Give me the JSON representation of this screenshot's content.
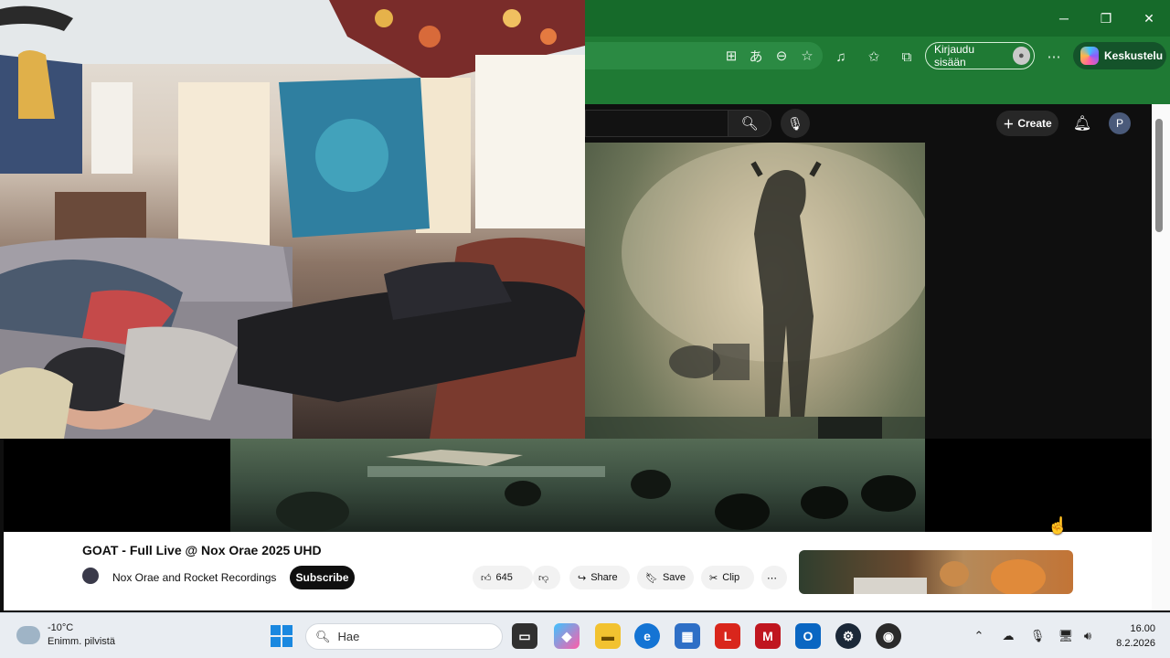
{
  "browser": {
    "window_controls": {
      "minimize": "─",
      "restore": "❐",
      "close": "✕"
    },
    "signin_label": "Kirjaudu sisään",
    "copilot_label": "Keskustelu",
    "more_icon": "⋯"
  },
  "youtube": {
    "create_label": "Create",
    "avatar_letter": "P",
    "video": {
      "title": "GOAT - Full Live @ Nox Orae 2025 UHD",
      "channel": "Nox Orae and Rocket Recordings",
      "subscribe_label": "Subscribe",
      "likes": "645",
      "share_label": "Share",
      "save_label": "Save",
      "clip_label": "Clip"
    }
  },
  "taskbar": {
    "weather": {
      "temp": "-10°C",
      "condition": "Enimm. pilvistä"
    },
    "search_placeholder": "Hae",
    "apps": [
      "file-explorer",
      "copilot",
      "folders",
      "edge",
      "microsoft-store",
      "lastpass",
      "mcafee",
      "outlook-new",
      "steam",
      "obs"
    ],
    "clock": {
      "time": "16.00",
      "date": "8.2.2026"
    }
  },
  "colors": {
    "browser_green": "#1f7a34",
    "youtube_dark": "#0f0f0f",
    "subscribe_black": "#0f0f0f"
  }
}
